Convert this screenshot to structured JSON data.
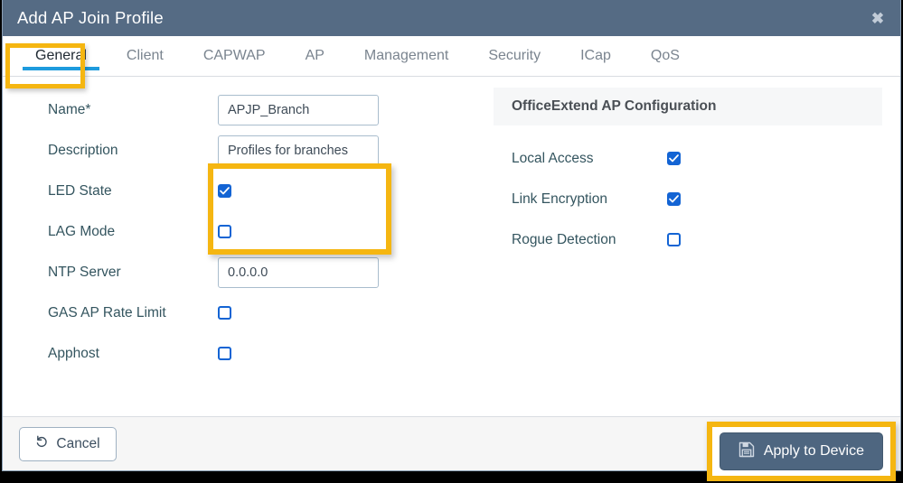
{
  "window": {
    "title": "Add AP Join Profile",
    "close_icon": "close-icon",
    "titlebar_color": "#556b84"
  },
  "tabs": [
    {
      "label": "General",
      "active": true
    },
    {
      "label": "Client",
      "active": false
    },
    {
      "label": "CAPWAP",
      "active": false
    },
    {
      "label": "AP",
      "active": false
    },
    {
      "label": "Management",
      "active": false
    },
    {
      "label": "Security",
      "active": false
    },
    {
      "label": "ICap",
      "active": false
    },
    {
      "label": "QoS",
      "active": false
    }
  ],
  "general_form": {
    "name": {
      "label": "Name*",
      "value": "APJP_Branch",
      "placeholder": ""
    },
    "description": {
      "label": "Description",
      "value": "Profiles for branches",
      "placeholder": ""
    },
    "led_state": {
      "label": "LED State",
      "checked": true
    },
    "lag_mode": {
      "label": "LAG Mode",
      "checked": false
    },
    "ntp_server": {
      "label": "NTP Server",
      "value": "0.0.0.0",
      "placeholder": ""
    },
    "gas_ap_rate_limit": {
      "label": "GAS AP Rate Limit",
      "checked": false
    },
    "apphost": {
      "label": "Apphost",
      "checked": false
    }
  },
  "officeextend": {
    "header": "OfficeExtend AP Configuration",
    "local_access": {
      "label": "Local Access",
      "checked": true
    },
    "link_encryption": {
      "label": "Link Encryption",
      "checked": true
    },
    "rogue_detection": {
      "label": "Rogue Detection",
      "checked": false
    }
  },
  "footer": {
    "cancel_label": "Cancel",
    "cancel_icon": "undo-arrow-icon",
    "apply_label": "Apply to Device",
    "apply_icon": "save-floppy-icon"
  },
  "annotations": {
    "highlight_color": "#f5b611",
    "accent_blue": "#1e9bdd",
    "checkbox_blue": "#1364d4"
  }
}
